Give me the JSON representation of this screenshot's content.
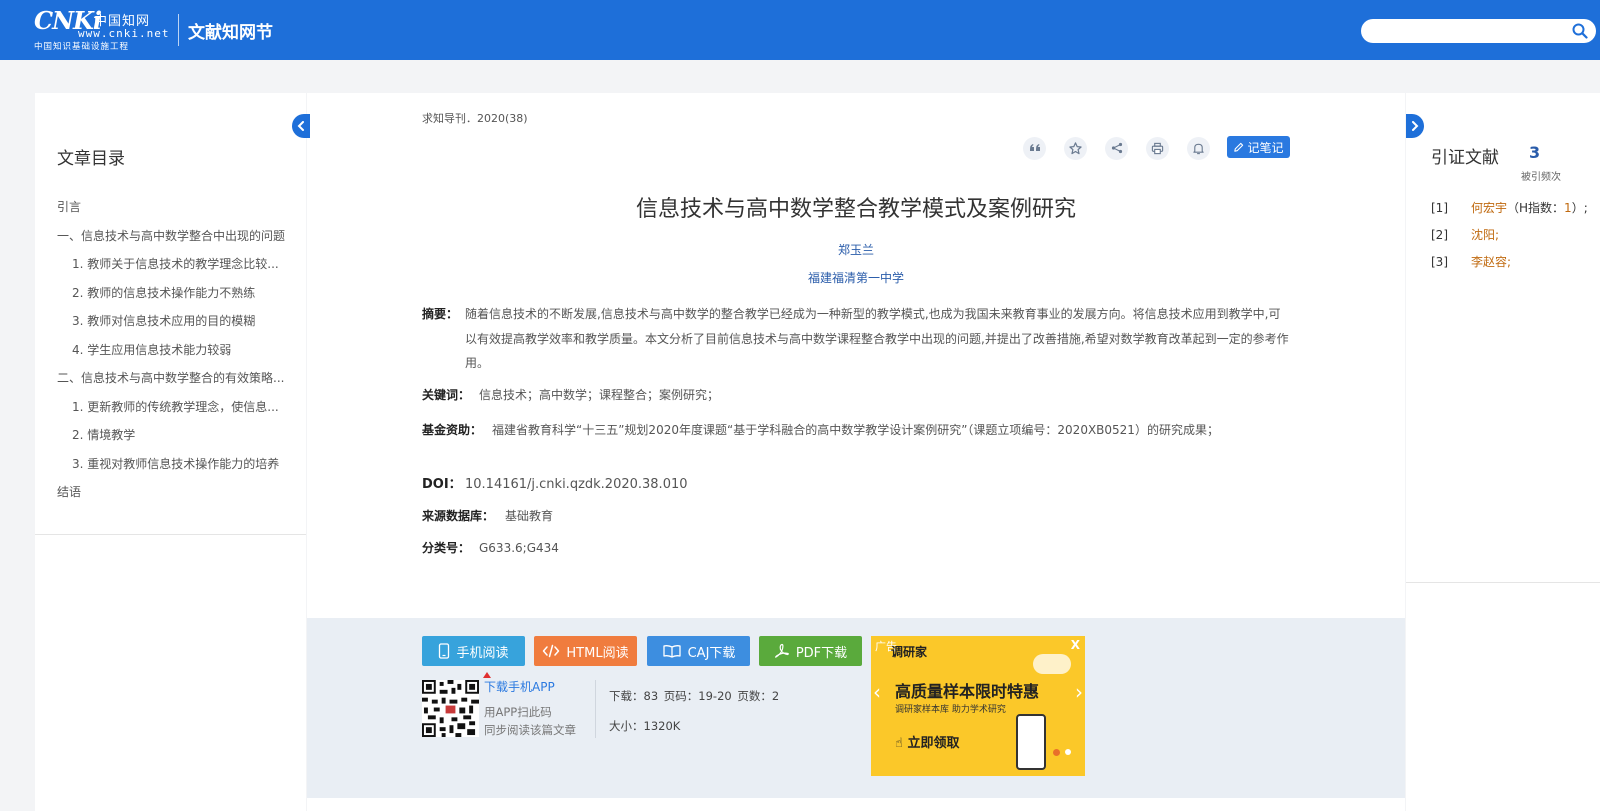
{
  "header": {
    "logo_mark": "CNKi",
    "logo_cn": "中国知网",
    "logo_url": "www.cnki.net",
    "logo_sub": "中国知识基础设施工程",
    "brand": "文献知网节",
    "search_placeholder": ""
  },
  "toc": {
    "title": "文章目录",
    "items": [
      {
        "label": "引言"
      },
      {
        "label": "一、信息技术与高中数学整合中出现的问题"
      },
      {
        "label": "1. 教师关于信息技术的教学理念比较..."
      },
      {
        "label": "2. 教师的信息技术操作能力不熟练"
      },
      {
        "label": "3. 教师对信息技术应用的目的模糊"
      },
      {
        "label": "4. 学生应用信息技术能力较弱"
      },
      {
        "label": "二、信息技术与高中数学整合的有效策略..."
      },
      {
        "label": "1. 更新教师的传统教学理念，使信息..."
      },
      {
        "label": "2. 情境教学"
      },
      {
        "label": "3. 重视对教师信息技术操作能力的培养"
      },
      {
        "label": "结语"
      }
    ]
  },
  "article": {
    "source": "求知导刊．2020(38)",
    "note_label": "记笔记",
    "title": "信息技术与高中数学整合教学模式及案例研究",
    "author": "郑玉兰",
    "org": "福建福清第一中学",
    "abstract_label": "摘要：",
    "abstract": "随着信息技术的不断发展,信息技术与高中数学的整合教学已经成为一种新型的教学模式,也成为我国未来教育事业的发展方向。将信息技术应用到教学中,可以有效提高教学效率和教学质量。本文分析了目前信息技术与高中数学课程整合教学中出现的问题,并提出了改善措施,希望对数学教育改革起到一定的参考作用。",
    "keywords_label": "关键词：",
    "keywords": "信息技术；高中数学；课程整合；案例研究；",
    "fund_label": "基金资助：",
    "fund": "福建省教育科学“十三五”规划2020年度课题“基于学科融合的高中数学教学设计案例研究”（课题立项编号：2020XB0521）的研究成果；",
    "doi_label": "DOI：",
    "doi": "10.14161/j.cnki.qzdk.2020.38.010",
    "db_label": "来源数据库：",
    "db": "基础教育",
    "cls_label": "分类号：",
    "cls": "G633.6;G434"
  },
  "downloads": {
    "mobile": "手机阅读",
    "html": "HTML阅读",
    "caj": "CAJ下载",
    "pdf": "PDF下载",
    "app_link": "下载手机APP",
    "app_line1": "用APP扫此码",
    "app_line2": "同步阅读该篇文章",
    "stats1": "下载：83  页码：19-20  页数：2",
    "stats2": "大小：1320K"
  },
  "ad": {
    "tag": "广告",
    "brand": "调研家",
    "close": "X",
    "headline": "高质量样本限时特惠",
    "sub": "调研家样本库 助力学术研究",
    "cta": "立即领取"
  },
  "citations": {
    "title": "引证文献",
    "count": "3",
    "sub": "被引频次",
    "items": [
      {
        "num": "[1]",
        "name": "何宏宇",
        "hidx": "（H指数：",
        "hval": "1",
        "tail": "）;"
      },
      {
        "num": "[2]",
        "name": "沈阳;",
        "hidx": "",
        "hval": "",
        "tail": ""
      },
      {
        "num": "[3]",
        "name": "李赵容;",
        "hidx": "",
        "hval": "",
        "tail": ""
      }
    ]
  },
  "colors": {
    "header": "#1e6fd9",
    "accent_blue": "#2a79e0",
    "cite_orange": "#c06a10"
  }
}
